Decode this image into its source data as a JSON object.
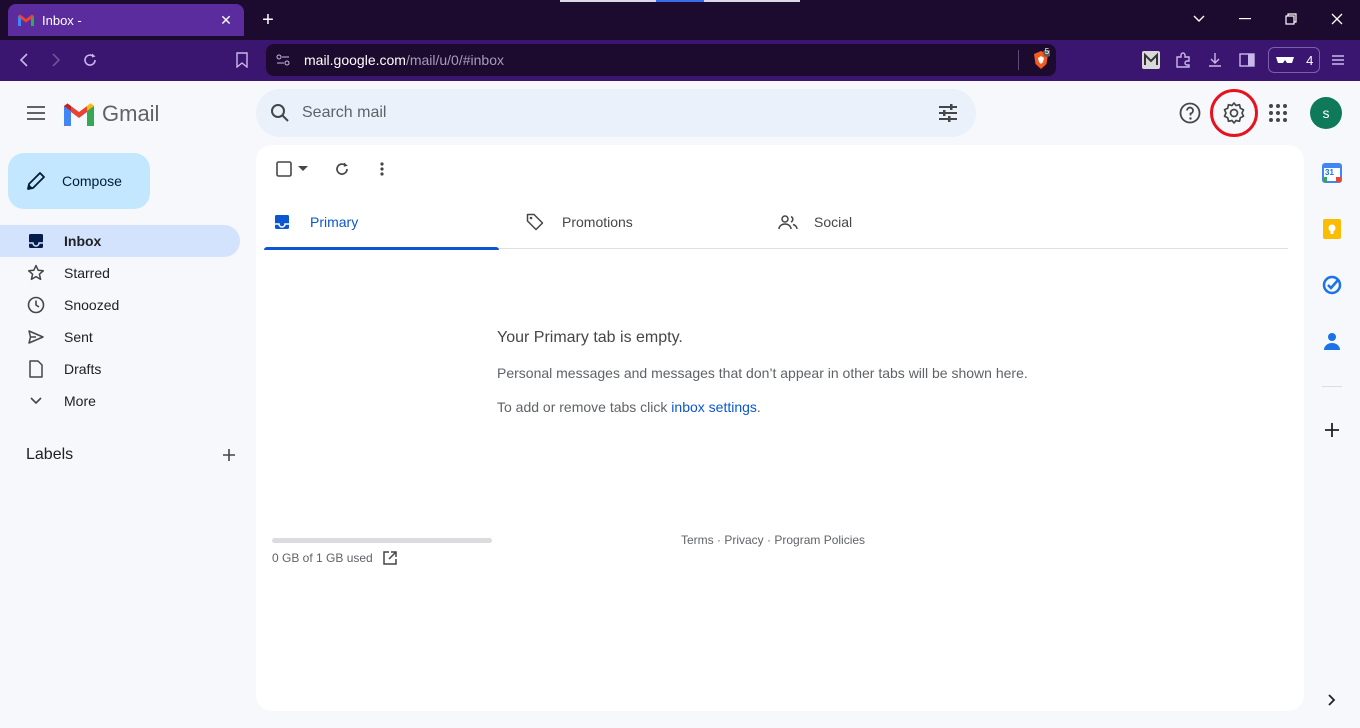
{
  "browser": {
    "tab_title": "Inbox -",
    "new_tab": "+",
    "url_host": "mail.google.com",
    "url_path": "/mail/u/0/#inbox",
    "shield_count": "5",
    "wallet_count": "4"
  },
  "gmail": {
    "logo_text": "Gmail",
    "search_placeholder": "Search mail",
    "avatar_letter": "s",
    "accent": "#0b57d0"
  },
  "sidebar": {
    "compose_label": "Compose",
    "items": [
      {
        "label": "Inbox",
        "icon": "inbox-icon"
      },
      {
        "label": "Starred",
        "icon": "star-icon"
      },
      {
        "label": "Snoozed",
        "icon": "clock-icon"
      },
      {
        "label": "Sent",
        "icon": "send-icon"
      },
      {
        "label": "Drafts",
        "icon": "draft-icon"
      },
      {
        "label": "More",
        "icon": "chevron-down-icon"
      }
    ],
    "labels_heading": "Labels"
  },
  "main": {
    "tabs": [
      {
        "label": "Primary",
        "icon": "inbox-icon"
      },
      {
        "label": "Promotions",
        "icon": "tag-icon"
      },
      {
        "label": "Social",
        "icon": "people-icon"
      }
    ],
    "empty_title": "Your Primary tab is empty.",
    "empty_text": "Personal messages and messages that don’t appear in other tabs will be shown here.",
    "empty_hint_prefix": "To add or remove tabs click ",
    "empty_hint_link": "inbox settings",
    "empty_hint_suffix": ".",
    "storage_text": "0 GB of 1 GB used",
    "storage_fraction": 0,
    "footer_terms": "Terms",
    "footer_privacy": "Privacy",
    "footer_policies": "Program Policies",
    "footer_sep": " · "
  },
  "side_panel": {
    "calendar_day": "31"
  }
}
